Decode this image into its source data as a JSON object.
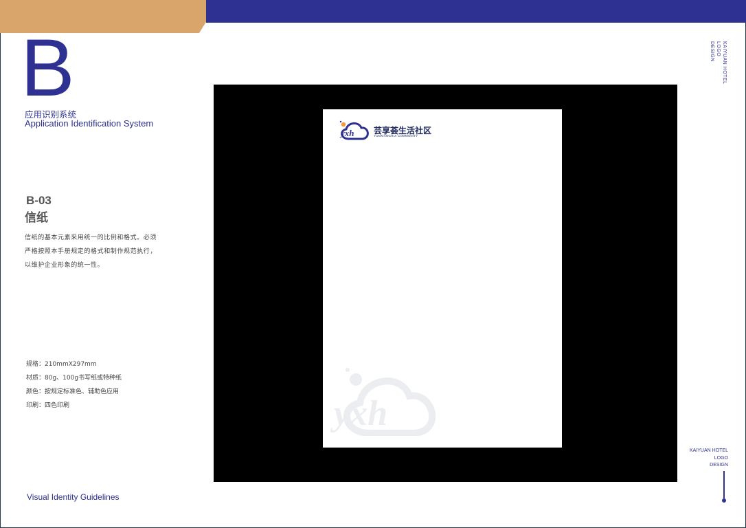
{
  "header": {
    "section_letter": "B",
    "section_title_cn": "应用识别系统",
    "section_title_en": "Application Identification System"
  },
  "item": {
    "code": "B-03",
    "title": "信纸",
    "description_lines": [
      "信纸的基本元素采用统一的比例和格式。必须",
      "严格按照本手册规定的格式和制作规范执行，",
      "以维护企业形象的统一性。"
    ],
    "specs": [
      "规格：210mmX297mm",
      "材质：80g、100g书写纸或特种纸",
      "颜色：按规定标准色、辅助色应用",
      "印刷：四色印刷"
    ]
  },
  "letterhead": {
    "logo_letters": "yxh",
    "logo_cn": "芸享荟生活社区",
    "logo_en": "YUNXIANGHUI COMMUNITY"
  },
  "footer": {
    "title": "Visual Identity Guidelines"
  },
  "side_label": {
    "lines": [
      "KAIYUAN  HOTEL",
      "LOGO",
      "DESIGN"
    ]
  },
  "corner_label": {
    "lines": [
      "KAIYUAN  HOTEL",
      "LOGO",
      "DESIGN"
    ]
  },
  "colors": {
    "brand_blue": "#2e3192",
    "accent_tan": "#d9a56b",
    "panel_black": "#000000",
    "logo_orange": "#f39a3d"
  }
}
